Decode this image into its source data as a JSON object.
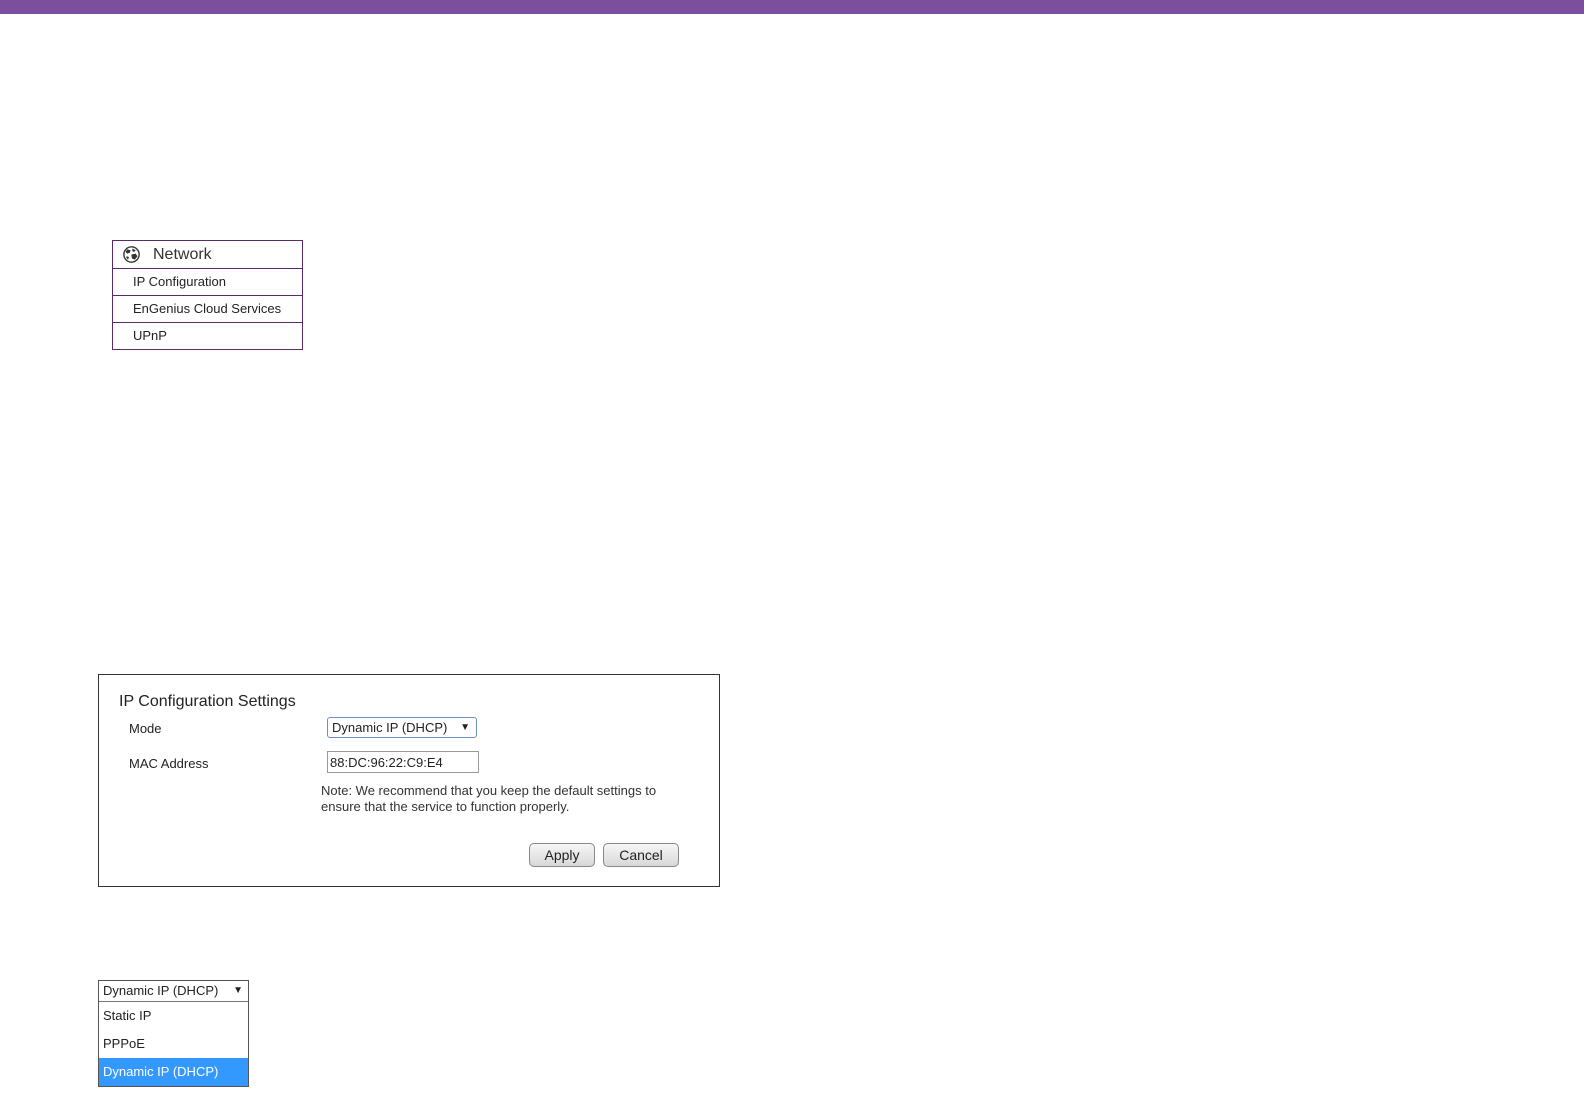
{
  "colors": {
    "top_bar": "#7b4f9e",
    "menu_border": "#5a2a6a",
    "selected_option_bg": "#3399ff"
  },
  "network_menu": {
    "header_icon": "globe-icon",
    "header": "Network",
    "items": [
      {
        "label": "IP Configuration"
      },
      {
        "label": "EnGenius Cloud Services"
      },
      {
        "label": "UPnP"
      }
    ]
  },
  "settings": {
    "title": "IP Configuration Settings",
    "mode_label": "Mode",
    "mode_value": "Dynamic IP (DHCP)",
    "mac_label": "MAC Address",
    "mac_value": "88:DC:96:22:C9:E4",
    "note": "Note: We recommend that you keep the default settings to ensure that the service to function properly.",
    "apply_label": "Apply",
    "cancel_label": "Cancel"
  },
  "mode_dropdown": {
    "current": "Dynamic IP (DHCP)",
    "options": [
      {
        "label": "Static IP"
      },
      {
        "label": "PPPoE"
      },
      {
        "label": "Dynamic IP (DHCP)"
      }
    ],
    "selected_index": 2
  }
}
